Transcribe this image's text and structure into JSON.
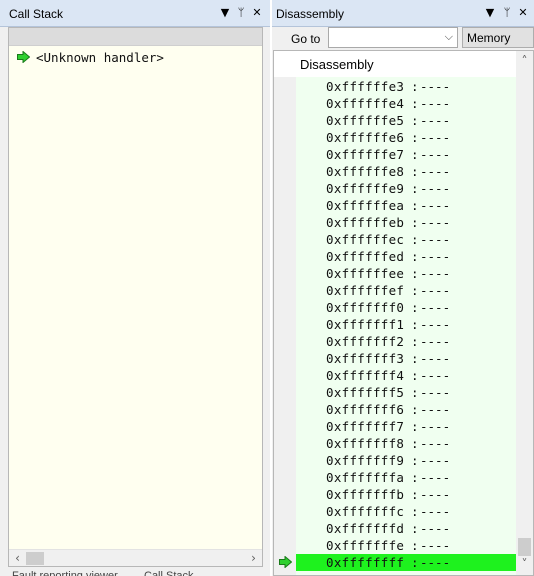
{
  "call_stack": {
    "title": "Call Stack",
    "buttons": {
      "dropdown": "▼",
      "pin": "ᛘ",
      "close": "✕"
    },
    "rows": [
      {
        "text": "<Unknown handler>"
      }
    ],
    "bottom_tabs": [
      "Fault reporting viewer",
      "Call Stack"
    ]
  },
  "disassembly": {
    "title": "Disassembly",
    "buttons": {
      "dropdown": "▼",
      "pin": "ᛘ",
      "close": "✕"
    },
    "toolbar": {
      "goto_label": "Go to",
      "goto_value": "",
      "memory_label": "Memory"
    },
    "header": "Disassembly",
    "separator": ":",
    "current_index": 28,
    "lines": [
      {
        "addr": "0xffffffe3",
        "instr": "----"
      },
      {
        "addr": "0xffffffe4",
        "instr": "----"
      },
      {
        "addr": "0xffffffe5",
        "instr": "----"
      },
      {
        "addr": "0xffffffe6",
        "instr": "----"
      },
      {
        "addr": "0xffffffe7",
        "instr": "----"
      },
      {
        "addr": "0xffffffe8",
        "instr": "----"
      },
      {
        "addr": "0xffffffe9",
        "instr": "----"
      },
      {
        "addr": "0xffffffea",
        "instr": "----"
      },
      {
        "addr": "0xffffffeb",
        "instr": "----"
      },
      {
        "addr": "0xffffffec",
        "instr": "----"
      },
      {
        "addr": "0xffffffed",
        "instr": "----"
      },
      {
        "addr": "0xffffffee",
        "instr": "----"
      },
      {
        "addr": "0xffffffef",
        "instr": "----"
      },
      {
        "addr": "0xfffffff0",
        "instr": "----"
      },
      {
        "addr": "0xfffffff1",
        "instr": "----"
      },
      {
        "addr": "0xfffffff2",
        "instr": "----"
      },
      {
        "addr": "0xfffffff3",
        "instr": "----"
      },
      {
        "addr": "0xfffffff4",
        "instr": "----"
      },
      {
        "addr": "0xfffffff5",
        "instr": "----"
      },
      {
        "addr": "0xfffffff6",
        "instr": "----"
      },
      {
        "addr": "0xfffffff7",
        "instr": "----"
      },
      {
        "addr": "0xfffffff8",
        "instr": "----"
      },
      {
        "addr": "0xfffffff9",
        "instr": "----"
      },
      {
        "addr": "0xfffffffa",
        "instr": "----"
      },
      {
        "addr": "0xfffffffb",
        "instr": "----"
      },
      {
        "addr": "0xfffffffc",
        "instr": "----"
      },
      {
        "addr": "0xfffffffd",
        "instr": "----"
      },
      {
        "addr": "0xfffffffe",
        "instr": "----"
      },
      {
        "addr": "0xffffffff",
        "instr": "----"
      }
    ]
  },
  "colors": {
    "current_line": "#1ef21e",
    "code_background": "#f0fff0",
    "call_stack_background": "#fffff0",
    "title_bar": "#dbe6f4",
    "arrow_green": "#2fd02f"
  }
}
